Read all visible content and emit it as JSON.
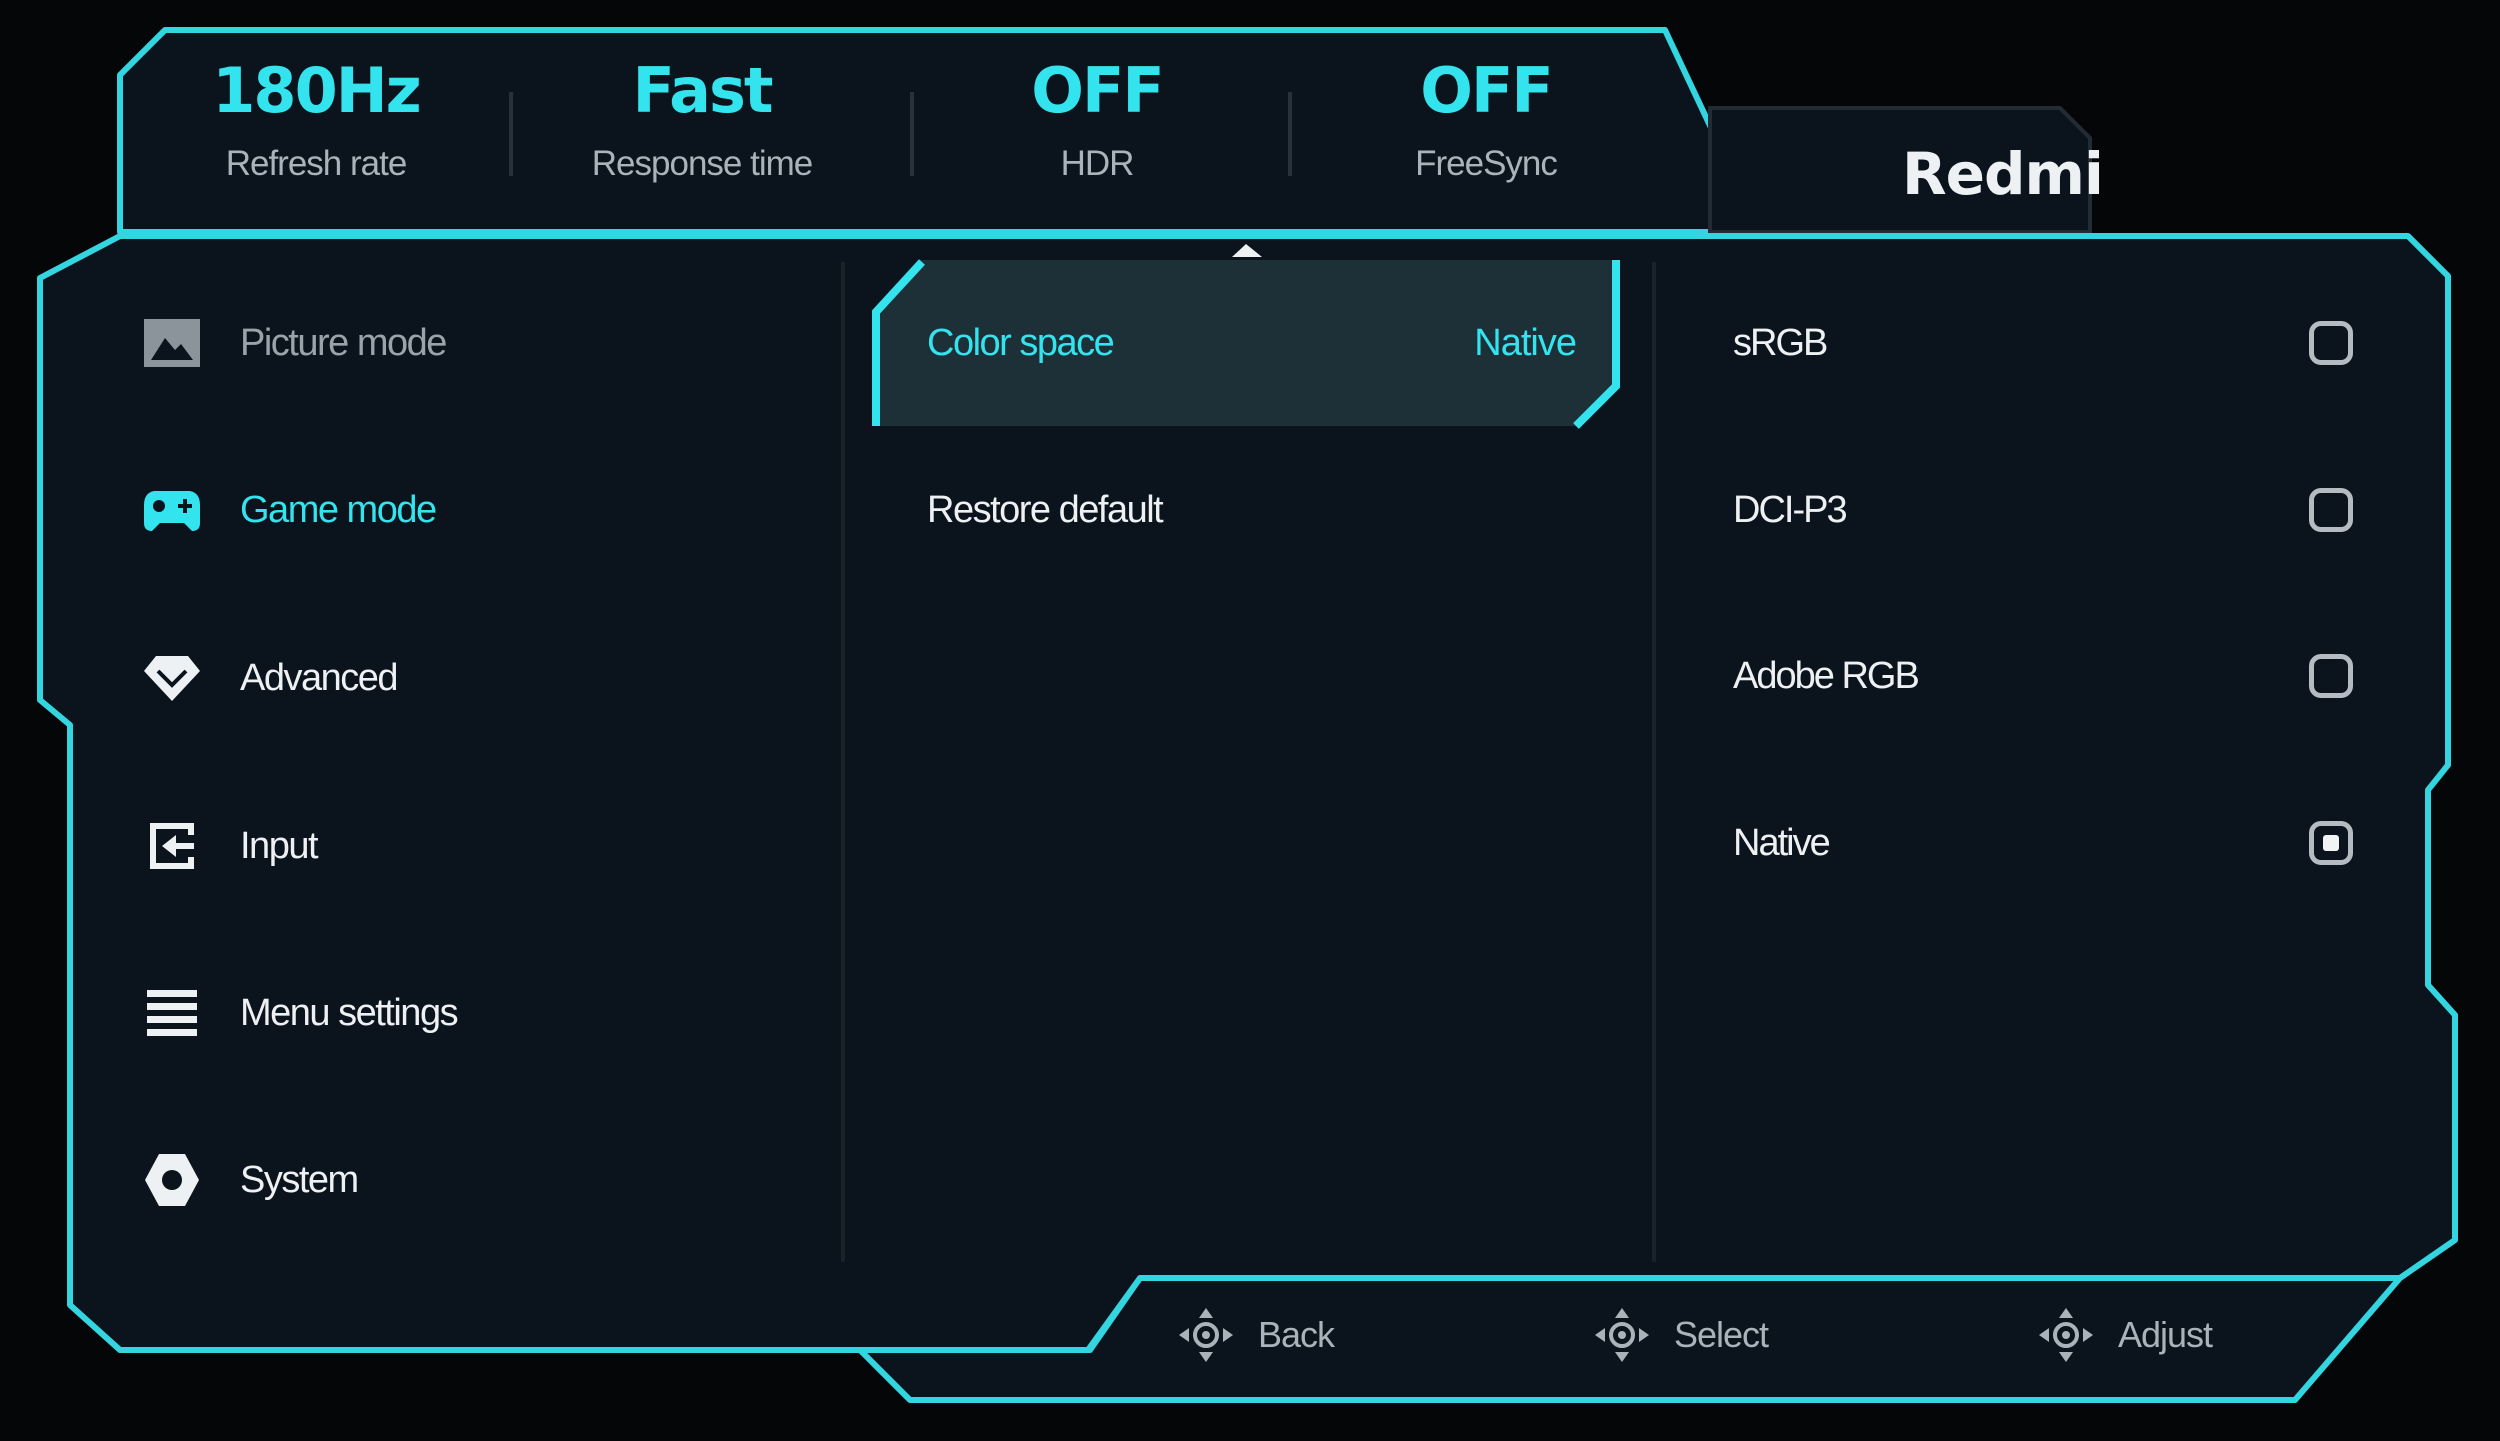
{
  "colors": {
    "accent": "#33e3ee",
    "panel": "#0b141c",
    "background": "#050608"
  },
  "status": [
    {
      "value": "180Hz",
      "label": "Refresh rate"
    },
    {
      "value": "Fast",
      "label": "Response time"
    },
    {
      "value": "OFF",
      "label": "HDR"
    },
    {
      "value": "OFF",
      "label": "FreeSync"
    }
  ],
  "brand": "Redmi",
  "nav": [
    {
      "label": "Picture mode",
      "icon": "picture-icon"
    },
    {
      "label": "Game mode",
      "icon": "gamepad-icon"
    },
    {
      "label": "Advanced",
      "icon": "diamond-icon"
    },
    {
      "label": "Input",
      "icon": "input-icon"
    },
    {
      "label": "Menu settings",
      "icon": "menu-icon"
    },
    {
      "label": "System",
      "icon": "gear-icon"
    }
  ],
  "submenu": [
    {
      "label": "Color space",
      "value": "Native"
    },
    {
      "label": "Restore default",
      "value": ""
    }
  ],
  "options": [
    {
      "label": "sRGB",
      "selected": false
    },
    {
      "label": "DCI-P3",
      "selected": false
    },
    {
      "label": "Adobe RGB",
      "selected": false
    },
    {
      "label": "Native",
      "selected": true
    }
  ],
  "footer": [
    {
      "label": "Back",
      "icon": "dpad-icon"
    },
    {
      "label": "Select",
      "icon": "dpad-icon"
    },
    {
      "label": "Adjust",
      "icon": "dpad-icon"
    }
  ]
}
